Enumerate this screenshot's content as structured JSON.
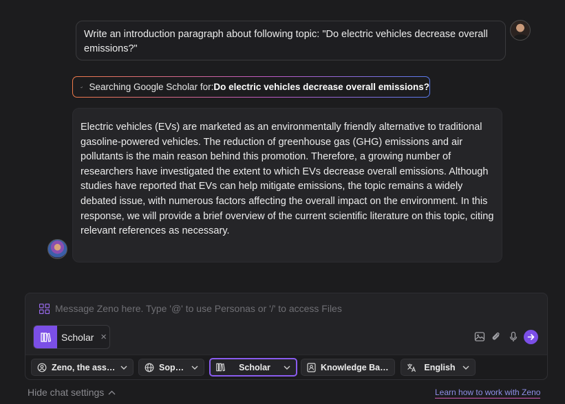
{
  "conversation": {
    "user_message": "Write an introduction paragraph about following topic: \"Do electric vehicles decrease overall emissions?\"",
    "search_status": {
      "prefix": "Searching Google Scholar for: ",
      "query": "Do electric vehicles decrease overall emissions?"
    },
    "assistant_message": "Electric vehicles (EVs) are marketed as an environmentally friendly alternative to traditional gasoline-powered vehicles. The reduction of greenhouse gas (GHG) emissions and air pollutants is the main reason behind this promotion. Therefore, a growing number of researchers have investigated the extent to which EVs decrease overall emissions. Although studies have reported that EVs can help mitigate emissions, the topic remains a widely debated issue, with numerous factors affecting the overall impact on the environment. In this response, we will provide a brief overview of the current scientific literature on this topic, citing relevant references as necessary."
  },
  "composer": {
    "placeholder": "Message Zeno here. Type '@' to use Personas or '/' to access Files",
    "active_chip": {
      "label": "Scholar",
      "close": "×"
    },
    "accent_color": "#7b4fe6"
  },
  "settings": {
    "persona": "Zeno, the assis...",
    "model": "Sopho...",
    "mode": "Scholar",
    "knowledge_base": "Knowledge Base",
    "language": "English"
  },
  "footer": {
    "hide_settings": "Hide chat settings",
    "learn_link": "Learn how to work with Zeno"
  },
  "icons": [
    "grid-icon",
    "image-icon",
    "paperclip-icon",
    "microphone-icon",
    "send-arrow-icon",
    "books-icon",
    "check-icon",
    "chevron-down-icon",
    "chevron-up-icon",
    "persona-icon",
    "globe-icon",
    "knowledge-base-icon",
    "translate-icon"
  ]
}
